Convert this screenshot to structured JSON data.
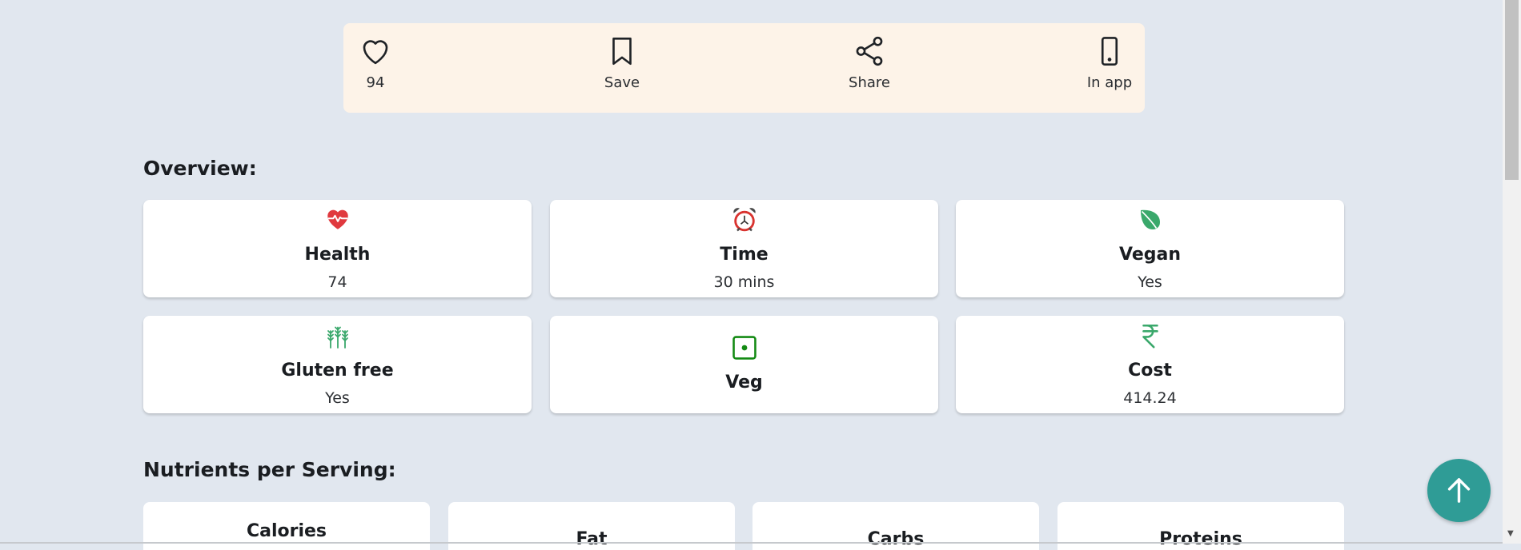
{
  "actions": {
    "likes": "94",
    "save": "Save",
    "share": "Share",
    "in_app": "In app"
  },
  "overview": {
    "title": "Overview:",
    "cards": [
      {
        "icon": "heartbeat-icon",
        "title": "Health",
        "value": "74"
      },
      {
        "icon": "alarm-clock-icon",
        "title": "Time",
        "value": "30 mins"
      },
      {
        "icon": "leaf-icon",
        "title": "Vegan",
        "value": "Yes"
      },
      {
        "icon": "wheat-icon",
        "title": "Gluten free",
        "value": "Yes"
      },
      {
        "icon": "veg-mark-icon",
        "title": "Veg"
      },
      {
        "icon": "rupee-icon",
        "title": "Cost",
        "value": "414.24"
      }
    ]
  },
  "nutrients": {
    "title": "Nutrients per Serving:",
    "cards": [
      "Calories",
      "Fat",
      "Carbs",
      "Proteins"
    ]
  },
  "colors": {
    "background": "#e1e7ef",
    "action_bar": "#fdf3e8",
    "health_red": "#e0393e",
    "vegan_green": "#3aa86b",
    "veg_green": "#138a13",
    "scroll_button": "#2f9c96"
  }
}
